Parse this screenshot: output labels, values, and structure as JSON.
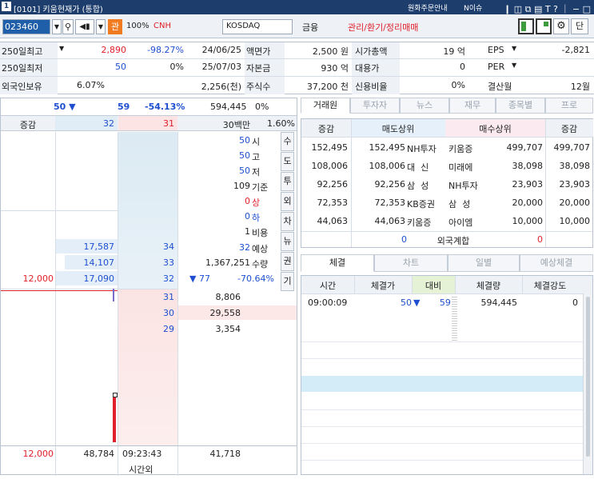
{
  "window": {
    "title": "[0101] 키움현재가 (통합)",
    "icon_label": "1",
    "right_items": [
      "원화주문안내",
      "N이슈"
    ]
  },
  "toolbar": {
    "code": "023460",
    "badge": "관",
    "pct": "100%",
    "name": "CNH",
    "market": "KOSDAQ",
    "sector": "금융",
    "status": "관리/환기/정리매매",
    "dan": "단"
  },
  "info": {
    "r1": {
      "l1": "250일최고",
      "v1": "2,890",
      "v2": "-98.27%",
      "v3": "24/06/25",
      "l2": "액면가",
      "v4": "2,500 원",
      "l3": "시가총액",
      "v5": "19 억",
      "l4": "EPS",
      "v6": "-2,821"
    },
    "r2": {
      "l1": "250일최저",
      "v1": "50",
      "v2": "0%",
      "v3": "25/07/03",
      "l2": "자본금",
      "v4": "930 억",
      "l3": "대용가",
      "v5": "0",
      "l4": "PER",
      "v6": ""
    },
    "r3": {
      "l1": "외국인보유",
      "v2": "6.07%",
      "v3": "2,256(천)",
      "l2": "주식수",
      "v4": "37,200 천",
      "l3": "신용비율",
      "v5": "0%",
      "l4": "결산월",
      "v6": "12월"
    }
  },
  "quote": {
    "price": "50 ▼",
    "change": "59",
    "rate": "-54.13%",
    "volume": "594,445",
    "vol_pct": "0%",
    "hdr_label": "증감",
    "hdr_ask": "32",
    "hdr_bid": "31",
    "hdr_amount": "30백만",
    "hdr_pct": "1.60%",
    "summary": [
      {
        "value": "50",
        "label": "시"
      },
      {
        "value": "50",
        "label": "고"
      },
      {
        "value": "50",
        "label": "저"
      },
      {
        "value": "109",
        "label": "기준"
      },
      {
        "value": "0",
        "label": "상"
      },
      {
        "value": "0",
        "label": "하"
      },
      {
        "value": "1",
        "label": "비용"
      }
    ],
    "side_buttons": [
      "수",
      "도",
      "투",
      "외",
      "차",
      "뉴",
      "권",
      "기"
    ],
    "ask_rows": [
      {
        "chg": "",
        "qty": "17,587",
        "price": "34"
      },
      {
        "chg": "",
        "qty": "14,107",
        "price": "33"
      },
      {
        "chg": "12,000",
        "qty": "17,090",
        "price": "32"
      }
    ],
    "expected": {
      "value": "32",
      "label": "예상"
    },
    "exp_volume": {
      "value": "1,367,251",
      "label": "수량"
    },
    "exp_change": {
      "value": "▼ 77",
      "rate": "-70.64%"
    },
    "bid_rows": [
      {
        "price": "31",
        "qty": "8,806"
      },
      {
        "price": "30",
        "qty": "29,558"
      },
      {
        "price": "29",
        "qty": "3,354"
      }
    ],
    "footer": {
      "chg": "12,000",
      "ask_total": "48,784",
      "time": "09:23:43",
      "bid_total": "41,718",
      "after_hours": "시간외"
    }
  },
  "broker": {
    "tabs": [
      "거래원",
      "투자자",
      "뉴스",
      "재무",
      "종목별",
      "프로"
    ],
    "headers": [
      "증감",
      "매도상위",
      "매수상위",
      "증감"
    ],
    "rows": [
      {
        "c1": "152,495",
        "sell_qty": "152,495",
        "sell_name": "NH투자",
        "buy_name": "키움증",
        "buy_qty": "499,707",
        "c2": "499,707"
      },
      {
        "c1": "108,006",
        "sell_qty": "108,006",
        "sell_name": "대  신",
        "buy_name": "미래에",
        "buy_qty": "38,098",
        "c2": "38,098"
      },
      {
        "c1": "92,256",
        "sell_qty": "92,256",
        "sell_name": "삼  성",
        "buy_name": "NH투자",
        "buy_qty": "23,903",
        "c2": "23,903"
      },
      {
        "c1": "72,353",
        "sell_qty": "72,353",
        "sell_name": "KB증권",
        "buy_name": "삼  성",
        "buy_qty": "20,000",
        "c2": "20,000"
      },
      {
        "c1": "44,063",
        "sell_qty": "44,063",
        "sell_name": "키움증",
        "buy_name": "아이엠",
        "buy_qty": "10,000",
        "c2": "10,000"
      }
    ],
    "foreign": {
      "sell": "0",
      "label": "외국계합",
      "buy": "0"
    }
  },
  "trades": {
    "tabs": [
      "체결",
      "차트",
      "일별",
      "예상체결"
    ],
    "headers": [
      "시간",
      "체결가",
      "대비",
      "체결량",
      "체결강도"
    ],
    "rows": [
      {
        "time": "09:00:09",
        "price": "50",
        "change": "▼       59",
        "qty": "594,445",
        "strength": "0"
      }
    ]
  },
  "colors": {
    "up": "#e0202a",
    "down": "#1f4fd0",
    "header": "#1d3d6c"
  }
}
